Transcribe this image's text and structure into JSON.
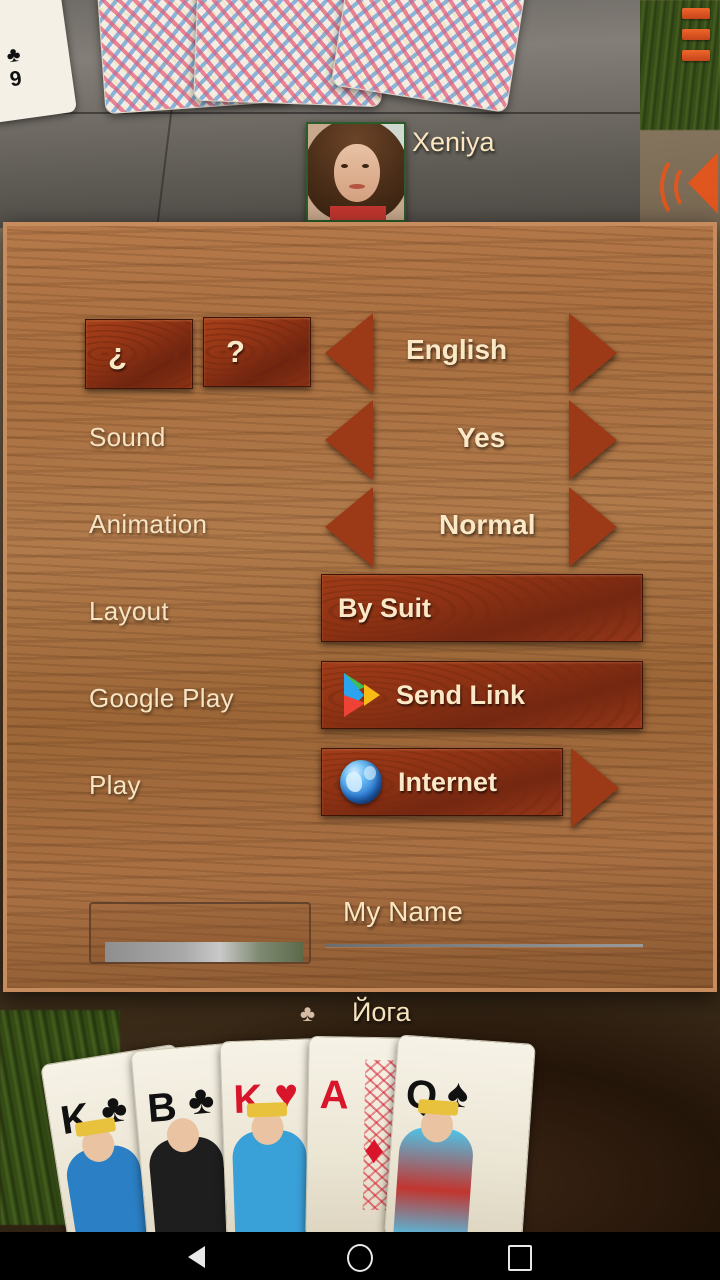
{
  "app": {
    "opponent": {
      "name": "Xeniya"
    },
    "player": {
      "name": "Йога",
      "suit_icon": "♣"
    }
  },
  "top_icons": {
    "menu": "hamburger-menu-icon",
    "sound": "sound-speaker-icon"
  },
  "settings": {
    "info_button": "¿",
    "help_button": "?",
    "rows": [
      {
        "label": "",
        "value": "English",
        "left_arrow": "◀",
        "right_arrow": "▶",
        "name": "language"
      },
      {
        "label": "Sound",
        "value": "Yes",
        "left_arrow": "◀",
        "right_arrow": "▶",
        "name": "sound"
      },
      {
        "label": "Animation",
        "value": "Normal",
        "left_arrow": "◀",
        "right_arrow": "▶",
        "name": "animation"
      },
      {
        "label": "Layout",
        "value": "By Suit",
        "name": "layout"
      },
      {
        "label": "Google Play",
        "value": "Send Link",
        "icon": "google-play-icon",
        "name": "google-play"
      },
      {
        "label": "Play",
        "value": "Internet",
        "icon": "globe-icon",
        "right_arrow": "▶",
        "name": "play"
      }
    ],
    "name_field": {
      "label": "My Name",
      "value": "",
      "placeholder": ""
    }
  },
  "hand": {
    "cards": [
      {
        "rank": "K",
        "suit": "♣",
        "color": "black"
      },
      {
        "rank": "B",
        "suit": "♣",
        "color": "black"
      },
      {
        "rank": "K",
        "suit": "♥",
        "color": "red"
      },
      {
        "rank": "A",
        "suit": "♦",
        "color": "red"
      },
      {
        "rank": "Q",
        "suit": "♠",
        "color": "black"
      }
    ]
  },
  "left_card": {
    "rank": "9",
    "suit": "♣"
  },
  "navbar": {
    "back": "back-triangle",
    "home": "home-circle",
    "recents": "recents-square"
  }
}
